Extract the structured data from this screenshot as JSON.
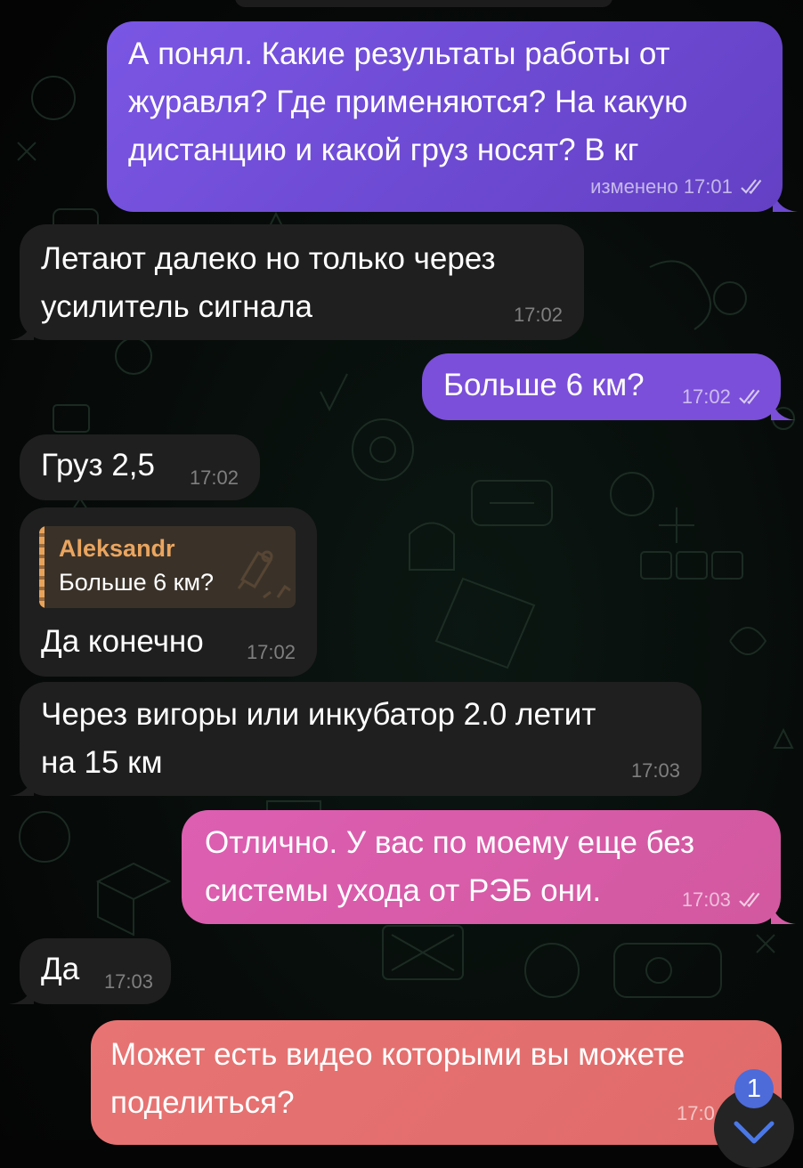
{
  "messages": [
    {
      "text": "А понял. Какие результаты работы от\nжуравля? Где применяются? На какую\nдистанцию и какой груз носят? В кг",
      "status": "изменено",
      "time": "17:01"
    },
    {
      "text": "Летают далеко но только через\nусилитель сигнала",
      "time": "17:02"
    },
    {
      "text": "Больше 6 км?",
      "time": "17:02"
    },
    {
      "text": "Груз 2,5",
      "time": "17:02"
    },
    {
      "reply_author": "Aleksandr",
      "reply_text": "Больше 6 км?",
      "text": "Да конечно",
      "time": "17:02"
    },
    {
      "text": "Через вигоры или инкубатор 2.0 летит\nна 15 км",
      "time": "17:03"
    },
    {
      "text": "Отлично. У вас по моему еще без\nсистемы ухода от РЭБ они.",
      "time": "17:03"
    },
    {
      "text": "Да",
      "time": "17:03"
    },
    {
      "text": "Может есть видео которыми вы можете\nподелиться?",
      "time": "17:0"
    }
  ],
  "scroll_down": {
    "unread_count": "1",
    "icon": "chevron-down-icon"
  },
  "colors": {
    "background": "#050505",
    "incoming_bubble": "#1f1f1f",
    "outgoing_purple": "#6f4bd6",
    "outgoing_magenta": "#d85aa8",
    "outgoing_coral": "#e46f6f",
    "reply_accent": "#eba55f",
    "badge": "#4d6bd9"
  }
}
